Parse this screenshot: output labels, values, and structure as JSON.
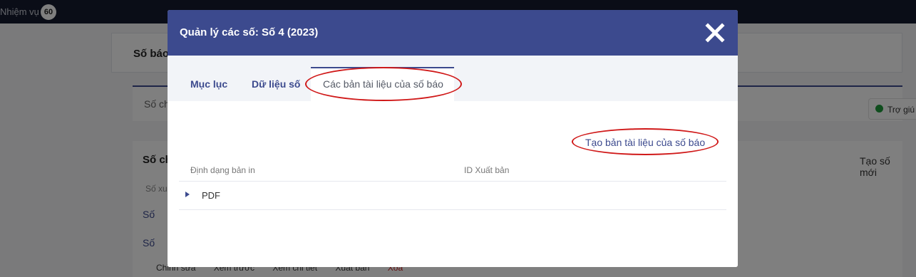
{
  "background": {
    "topbar": {
      "task_label": "Nhiệm vụ",
      "task_count": "60"
    },
    "card1_title": "Số báo",
    "card2_text": "Số chi",
    "help_label": "Trợ giú",
    "card3": {
      "heading": "Số ch",
      "new_button": "Tạo số mới",
      "subtext": "Số xu",
      "row1": "Số",
      "row2": "Số"
    },
    "actions": [
      "Chỉnh sửa",
      "Xem trước",
      "Xem chi tiết",
      "Xuất bản",
      "Xóa"
    ]
  },
  "modal": {
    "title": "Quản lý các số: Số 4 (2023)",
    "close_icon": "close-icon",
    "tabs": [
      {
        "label": "Mục lục",
        "active": false
      },
      {
        "label": "Dữ liệu số",
        "active": false
      },
      {
        "label": "Các bản tài liệu của số báo",
        "active": true
      }
    ],
    "create_link": "Tạo bản tài liệu của số báo",
    "table": {
      "columns": [
        "Định dạng bản in",
        "ID Xuất bản"
      ],
      "rows": [
        {
          "format": "PDF",
          "id": ""
        }
      ]
    }
  },
  "colors": {
    "header": "#3c4a8e",
    "annotation": "#d01919",
    "overlay": "rgba(0,0,0,0.5)"
  }
}
